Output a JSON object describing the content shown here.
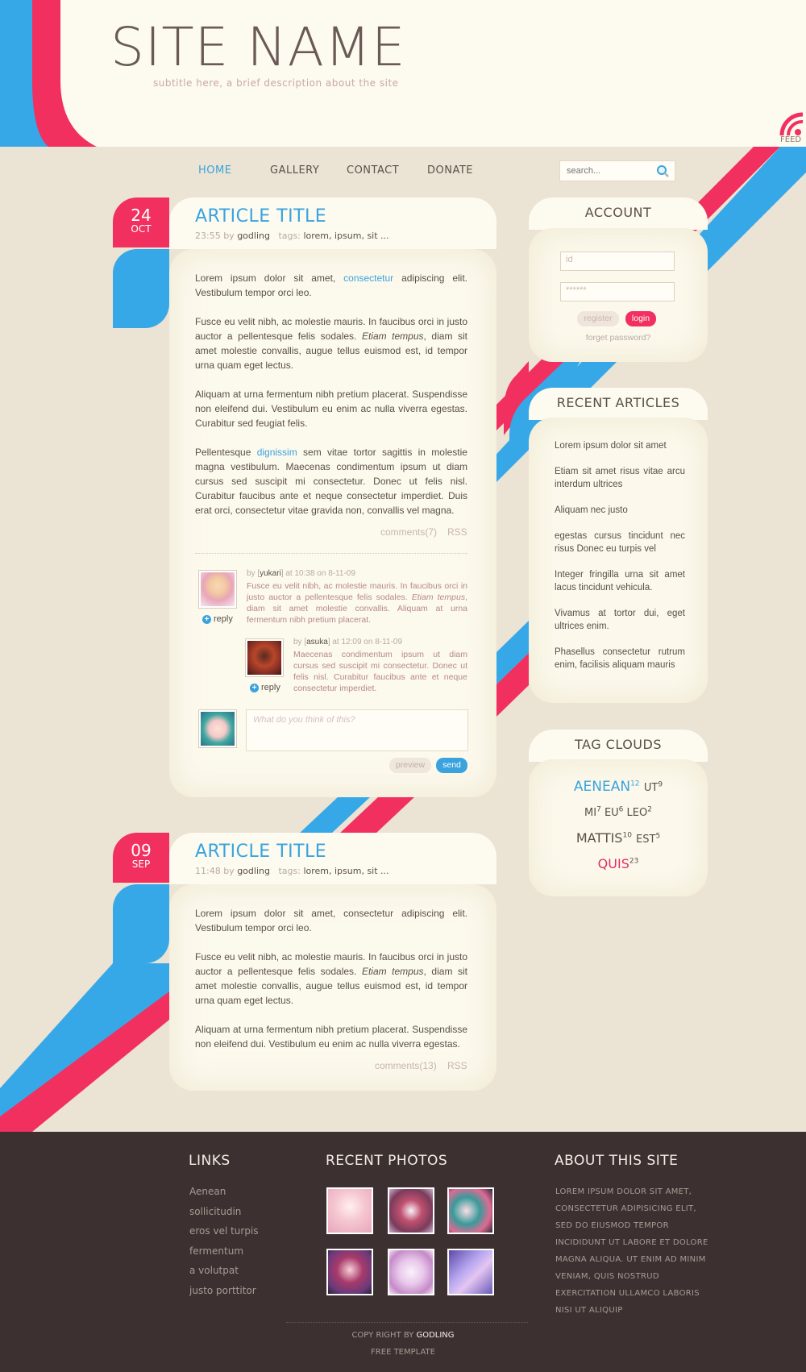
{
  "site": {
    "name": "SITE NAME",
    "subtitle": "subtitle here, a brief description about the site",
    "feed_label": "FEED"
  },
  "nav": {
    "items": [
      "HOME",
      "GALLERY",
      "CONTACT",
      "DONATE"
    ],
    "active": "HOME"
  },
  "search": {
    "placeholder": "search..."
  },
  "colors": {
    "pink": "#f2305f",
    "blue": "#36a8e8",
    "cream": "#fcf9ed",
    "beige": "#ebe3d3",
    "footer": "#3c3130"
  },
  "articles": [
    {
      "day": "24",
      "month": "OCT",
      "title": "ARTICLE TITLE",
      "time": "23:55",
      "by": "by",
      "author": "godling",
      "tags_label": "tags:",
      "tags": "lorem, ipsum, sit ...",
      "p1a": "Lorem ipsum dolor sit amet,",
      "p1link": "consectetur",
      "p1b": "adipiscing elit. Vestibulum tempor orci leo.",
      "p2a": "Fusce eu velit nibh, ac molestie mauris. In faucibus orci in justo auctor a pellentesque felis sodales.",
      "p2i": "Etiam tempus",
      "p2b": ", diam sit amet molestie convallis, augue tellus euismod est, id tempor urna quam eget lectus.",
      "p3": "Aliquam at urna fermentum nibh pretium placerat. Suspendisse non eleifend dui. Vestibulum eu enim ac nulla viverra egestas. Curabitur sed feugiat felis.",
      "p4a": "Pellentesque",
      "p4link": "dignissim",
      "p4b": "sem vitae tortor sagittis in molestie magna vestibulum. Maecenas condimentum ipsum ut diam cursus sed suscipit mi consectetur. Donec ut felis nisl. Curabitur faucibus ante et neque consectetur imperdiet. Duis erat orci, consectetur vitae gravida non, convallis vel magna.",
      "comments": "comments(7)",
      "rss": "RSS"
    },
    {
      "day": "09",
      "month": "SEP",
      "title": "ARTICLE TITLE",
      "time": "11:48",
      "by": "by",
      "author": "godling",
      "tags_label": "tags:",
      "tags": "lorem, ipsum, sit ...",
      "p1": "Lorem ipsum dolor sit amet, consectetur adipiscing elit. Vestibulum tempor orci leo.",
      "p2a": "Fusce eu velit nibh, ac molestie mauris. In faucibus orci in justo auctor a pellentesque felis sodales.",
      "p2i": "Etiam tempus",
      "p2b": ", diam sit amet molestie convallis, augue tellus euismod est, id tempor urna quam eget lectus.",
      "p3": "Aliquam at urna fermentum nibh pretium placerat. Suspendisse non eleifend dui. Vestibulum eu enim ac nulla viverra egestas.",
      "comments": "comments(13)",
      "rss": "RSS"
    }
  ],
  "comments": [
    {
      "by": "by [",
      "user": "yukari",
      "when": "] at 10:38 on 8-11-09",
      "text_a": "Fusce eu velit nibh, ac molestie mauris. In faucibus orci in justo auctor a pellentesque felis sodales.",
      "text_i": "Etiam tempus",
      "text_b": ", diam sit amet molestie convallis. Aliquam at urna fermentum nibh pretium placerat.",
      "reply": "reply"
    },
    {
      "by": "by [",
      "user": "asuka",
      "when": "] at 12:09 on 8-11-09",
      "text": "Maecenas condimentum ipsum ut diam cursus sed suscipit mi consectetur. Donec ut felis nisl. Curabitur faucibus ante et neque consectetur imperdiet.",
      "reply": "reply"
    }
  ],
  "comment_form": {
    "placeholder": "What do you think of this?",
    "preview": "preview",
    "send": "send"
  },
  "account": {
    "title": "ACCOUNT",
    "id_placeholder": "id",
    "password_placeholder": "******",
    "register": "register",
    "login": "login",
    "forgot": "forget password?"
  },
  "recent_articles": {
    "title": "RECENT ARTICLES",
    "items": [
      "Lorem ipsum dolor sit amet",
      "Etiam sit amet risus vitae arcu interdum ultrices",
      "Aliquam nec justo",
      "egestas cursus tincidunt nec risus Donec eu turpis vel",
      "Integer fringilla urna sit amet lacus tincidunt vehicula.",
      "Vivamus at tortor dui, eget ultrices enim.",
      "Phasellus consectetur rutrum enim, facilisis aliquam mauris"
    ]
  },
  "tag_cloud": {
    "title": "TAG CLOUDS",
    "tags": [
      {
        "name": "AENEAN",
        "count": "12"
      },
      {
        "name": "UT",
        "count": "9"
      },
      {
        "name": "MI",
        "count": "7"
      },
      {
        "name": "EU",
        "count": "6"
      },
      {
        "name": "LEO",
        "count": "2"
      },
      {
        "name": "MATTIS",
        "count": "10"
      },
      {
        "name": "EST",
        "count": "5"
      },
      {
        "name": "QUIS",
        "count": "23"
      }
    ]
  },
  "footer": {
    "links_title": "LINKS",
    "links": [
      "Aenean",
      "sollicitudin",
      "eros vel turpis",
      "fermentum",
      "a volutpat",
      "justo porttitor"
    ],
    "photos_title": "RECENT PHOTOS",
    "about_title": "ABOUT THIS SITE",
    "about_text": "LOREM IPSUM DOLOR SIT AMET, CONSECTETUR ADIPISICING ELIT, SED DO EIUSMOD TEMPOR INCIDIDUNT UT LABORE ET DOLORE MAGNA ALIQUA. UT ENIM AD MINIM VENIAM, QUIS NOSTRUD EXERCITATION ULLAMCO LABORIS NISI UT ALIQUIP",
    "copyright_prefix": "COPY RIGHT BY",
    "copyright_name": "GODLING",
    "free_template": "FREE TEMPLATE"
  }
}
